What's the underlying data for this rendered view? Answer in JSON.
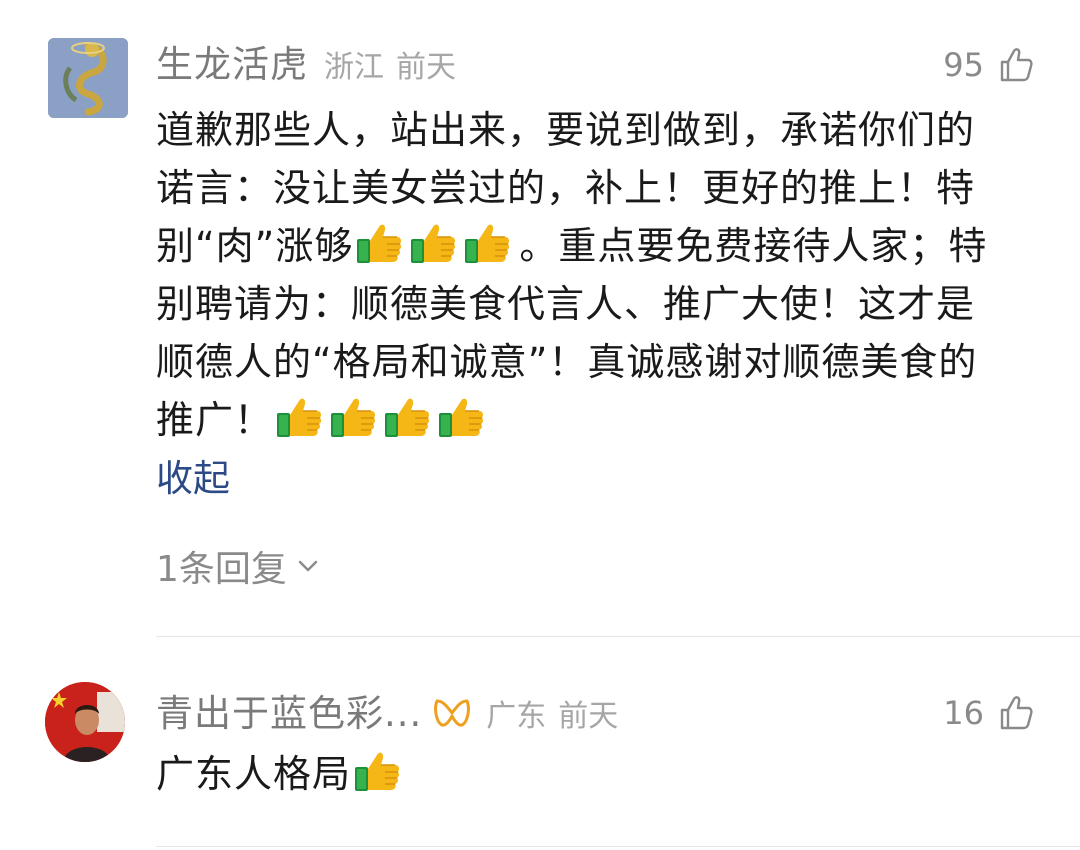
{
  "comments": [
    {
      "username": "生龙活虎",
      "location": "浙江",
      "time": "前天",
      "likes": "95",
      "lines": [
        "道歉那些人，站出来，要说到做到，承诺你们的",
        "诺言：没让美女尝过的，补上！更好的推上！特",
        "别“肉”涨够",
        "。重点要免费接待人家；特",
        "别聘请为：顺德美食代言人、推广大使！这才是",
        "顺德人的“格局和诚意”！真诚感谢对顺德美食的",
        "推广！"
      ],
      "collapse_label": "收起",
      "reply_label": "1条回复"
    },
    {
      "username": "青出于蓝色彩...",
      "location": "广东",
      "time": "前天",
      "likes": "16",
      "text": "广东人格局"
    }
  ],
  "icons": [
    "thumbs-up-outline-icon",
    "thumbs-up-emoji-icon",
    "chevron-down-icon",
    "vip-badge-icon",
    "dragon-avatar",
    "person-flag-avatar"
  ],
  "colors": {
    "username": "#7a7a7a",
    "meta": "#a6a6a6",
    "body_text": "#1a1a1a",
    "link": "#2b4a86",
    "badge": "#f0a020"
  }
}
